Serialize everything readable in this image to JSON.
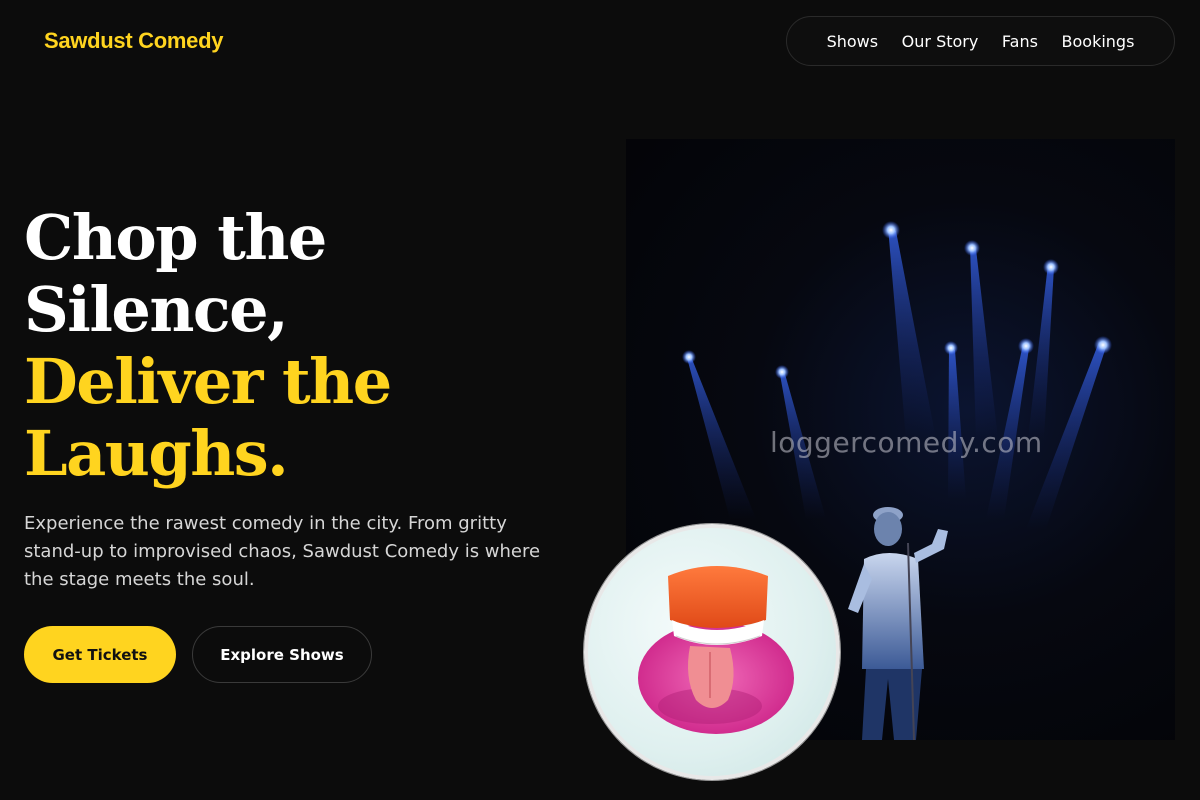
{
  "brand": {
    "name": "Sawdust Comedy",
    "accent": "#ffd41f"
  },
  "nav": {
    "items": [
      {
        "label": "Shows"
      },
      {
        "label": "Our Story"
      },
      {
        "label": "Fans"
      },
      {
        "label": "Bookings"
      }
    ]
  },
  "hero": {
    "headline_line1": "Chop the",
    "headline_line2": "Silence,",
    "headline_line3": "Deliver the",
    "headline_line4": "Laughs.",
    "subtext": "Experience the rawest comedy in the city. From gritty stand-up to improvised chaos, Sawdust Comedy is where the stage meets the soul.",
    "primary_button": "Get Tickets",
    "secondary_button": "Explore Shows"
  },
  "media": {
    "stage_image_watermark": "loggercomedy.com",
    "stage_image_icon": "comedian-on-stage-photo",
    "circle_image_icon": "joke-teeth-photo"
  }
}
